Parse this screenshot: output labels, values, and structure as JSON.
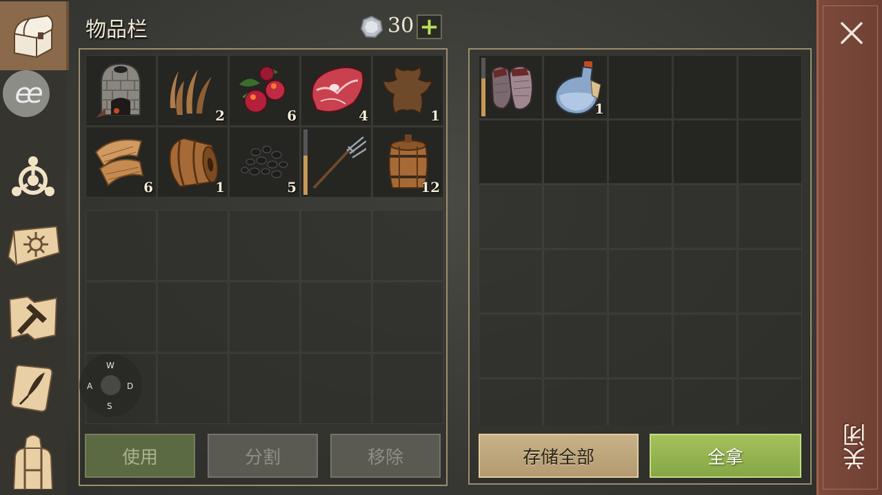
{
  "header": {
    "title": "物品栏",
    "coin_count": "30",
    "plus_label": "+"
  },
  "sidebar": {
    "items": [
      {
        "icon": "chest-icon",
        "active": true
      },
      {
        "icon": "ee-icon",
        "label": "ee"
      },
      {
        "icon": "crafting-icon"
      },
      {
        "icon": "skills-book-icon"
      },
      {
        "icon": "build-hammer-icon"
      },
      {
        "icon": "quest-scroll-icon"
      },
      {
        "icon": "character-icon"
      }
    ]
  },
  "inventory": {
    "items": [
      {
        "name": "kiln",
        "icon": "kiln-icon",
        "qty": ""
      },
      {
        "name": "plant-fiber",
        "icon": "fiber-icon",
        "qty": "2"
      },
      {
        "name": "berries",
        "icon": "berries-icon",
        "qty": "6"
      },
      {
        "name": "raw-meat",
        "icon": "meat-icon",
        "qty": "4"
      },
      {
        "name": "hide",
        "icon": "hide-icon",
        "qty": "1"
      },
      {
        "name": "cloth",
        "icon": "cloth-icon",
        "qty": "6"
      },
      {
        "name": "barrel",
        "icon": "barrel-icon",
        "qty": "1"
      },
      {
        "name": "coal",
        "icon": "coal-icon",
        "qty": "5"
      },
      {
        "name": "pitchfork",
        "icon": "pitchfork-icon",
        "qty": "",
        "durability": 0.6
      },
      {
        "name": "keg",
        "icon": "keg-icon",
        "qty": "12"
      }
    ],
    "buttons": {
      "use": "使用",
      "split": "分割",
      "remove": "移除"
    }
  },
  "container": {
    "items": [
      {
        "name": "chainmail-gloves",
        "icon": "gloves-icon",
        "qty": "",
        "durability": 0.65
      },
      {
        "name": "water-flask",
        "icon": "flask-icon",
        "qty": "1"
      }
    ],
    "buttons": {
      "store_all": "存储全部",
      "take_all": "全拿"
    }
  },
  "joystick": {
    "w": "W",
    "a": "A",
    "s": "S",
    "d": "D"
  },
  "close": {
    "label": "关闭"
  }
}
